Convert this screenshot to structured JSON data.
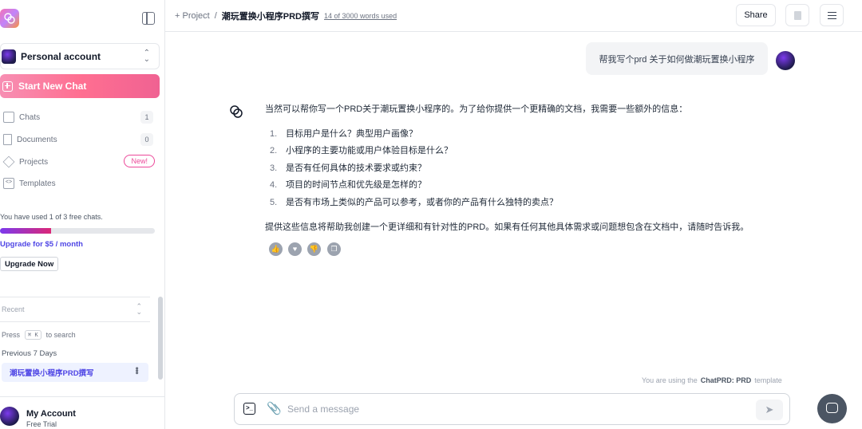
{
  "sidebar": {
    "account_label": "Personal account",
    "new_chat_label": "Start New Chat",
    "nav": [
      {
        "label": "Chats",
        "count": "1"
      },
      {
        "label": "Documents",
        "count": "0"
      },
      {
        "label": "Projects",
        "badge": "New!"
      },
      {
        "label": "Templates"
      }
    ],
    "usage_text": "You have used 1 of 3 free chats.",
    "usage_fraction": 0.33,
    "upgrade_link": "Upgrade for $5 / month",
    "upgrade_button": "Upgrade Now",
    "recent_label": "Recent",
    "search_prefix": "Press",
    "search_key": "⌘ K",
    "search_suffix": "to search",
    "section_label": "Previous 7 Days",
    "chat_items": [
      "潮玩置换小程序PRD撰写"
    ],
    "footer": {
      "name": "My Account",
      "plan": "Free Trial"
    }
  },
  "header": {
    "breadcrumb_root": "+ Project",
    "breadcrumb_sep": "/",
    "title": "潮玩置换小程序PRD撰写",
    "word_count": "14 of 3000 words used",
    "share_label": "Share"
  },
  "chat": {
    "user_message": "帮我写个prd 关于如何做潮玩置换小程序",
    "assistant": {
      "intro": "当然可以帮你写一个PRD关于潮玩置换小程序的。为了给你提供一个更精确的文档，我需要一些额外的信息：",
      "items": [
        {
          "num": "1.",
          "text": "目标用户是什么？典型用户画像？"
        },
        {
          "num": "2.",
          "text": "小程序的主要功能或用户体验目标是什么？"
        },
        {
          "num": "3.",
          "text": "是否有任何具体的技术要求或约束？"
        },
        {
          "num": "4.",
          "text": "项目的时间节点和优先级是怎样的？"
        },
        {
          "num": "5.",
          "text": "是否有市场上类似的产品可以参考，或者你的产品有什么独特的卖点？"
        }
      ],
      "outro": "提供这些信息将帮助我创建一个更详细和有针对性的PRD。如果有任何其他具体需求或问题想包含在文档中，请随时告诉我。"
    }
  },
  "template_note": {
    "prefix": "You are using the",
    "name": "ChatPRD: PRD",
    "suffix": "template"
  },
  "composer": {
    "placeholder": "Send a message"
  }
}
